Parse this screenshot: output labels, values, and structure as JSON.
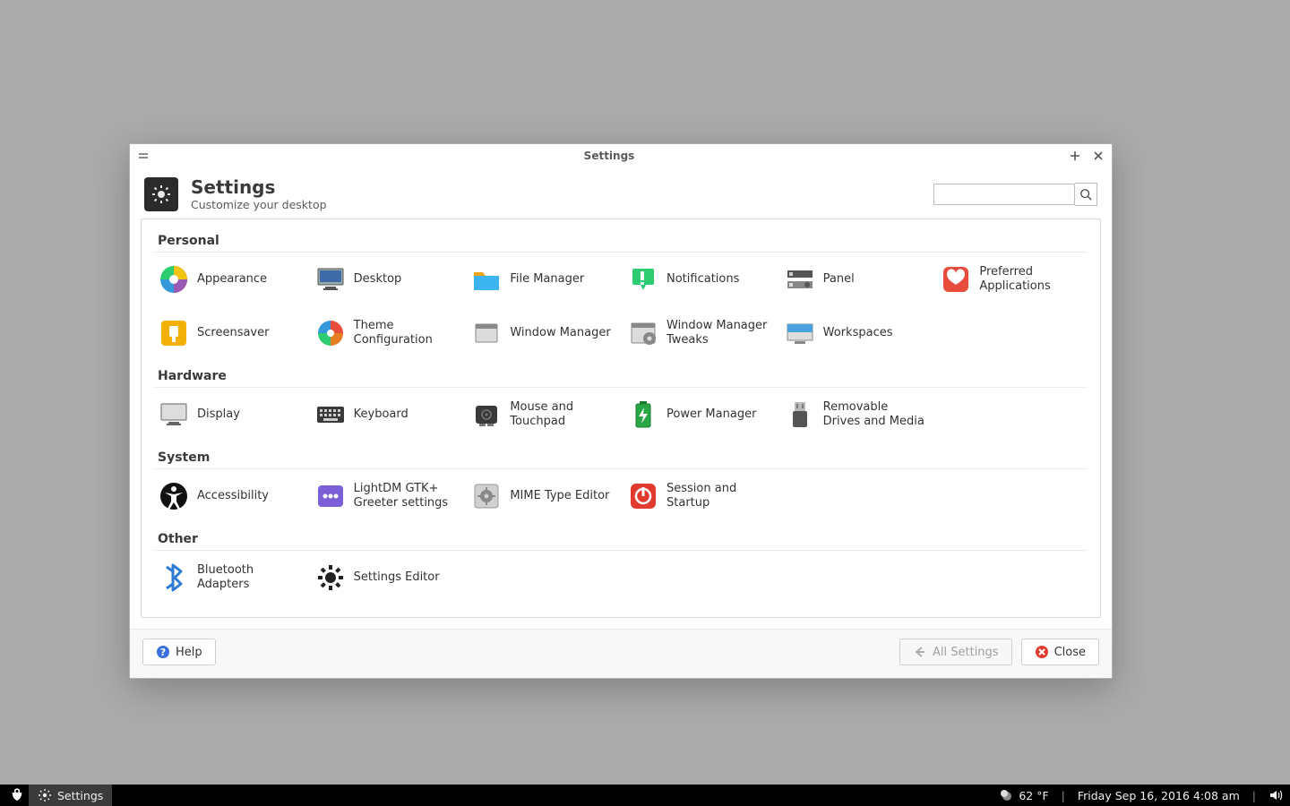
{
  "window": {
    "titlebar_title": "Settings",
    "header_title": "Settings",
    "header_subtitle": "Customize your desktop",
    "search_placeholder": ""
  },
  "categories": [
    {
      "title": "Personal",
      "items": [
        {
          "name": "appearance",
          "label": "Appearance"
        },
        {
          "name": "desktop",
          "label": "Desktop"
        },
        {
          "name": "file-manager",
          "label": "File Manager"
        },
        {
          "name": "notifications",
          "label": "Notifications"
        },
        {
          "name": "panel",
          "label": "Panel"
        },
        {
          "name": "preferred-apps",
          "label": "Preferred Applications"
        },
        {
          "name": "screensaver",
          "label": "Screensaver"
        },
        {
          "name": "theme-config",
          "label": "Theme Configuration"
        },
        {
          "name": "window-manager",
          "label": "Window Manager"
        },
        {
          "name": "wm-tweaks",
          "label": "Window Manager Tweaks"
        },
        {
          "name": "workspaces",
          "label": "Workspaces"
        }
      ]
    },
    {
      "title": "Hardware",
      "items": [
        {
          "name": "display",
          "label": "Display"
        },
        {
          "name": "keyboard",
          "label": "Keyboard"
        },
        {
          "name": "mouse-touchpad",
          "label": "Mouse and Touchpad"
        },
        {
          "name": "power-manager",
          "label": "Power Manager"
        },
        {
          "name": "removable-media",
          "label": "Removable Drives and Media"
        }
      ]
    },
    {
      "title": "System",
      "items": [
        {
          "name": "accessibility",
          "label": "Accessibility"
        },
        {
          "name": "lightdm-greeter",
          "label": "LightDM GTK+ Greeter settings"
        },
        {
          "name": "mime-editor",
          "label": "MIME Type Editor"
        },
        {
          "name": "session-startup",
          "label": "Session and Startup"
        }
      ]
    },
    {
      "title": "Other",
      "items": [
        {
          "name": "bluetooth-adapters",
          "label": "Bluetooth Adapters"
        },
        {
          "name": "settings-editor",
          "label": "Settings Editor"
        }
      ]
    }
  ],
  "buttons": {
    "help_label": "Help",
    "all_settings_label": "All Settings",
    "close_label": "Close"
  },
  "taskbar": {
    "active_task_label": "Settings",
    "weather": "62 °F",
    "clock": "Friday Sep 16, 2016  4:08 am"
  }
}
